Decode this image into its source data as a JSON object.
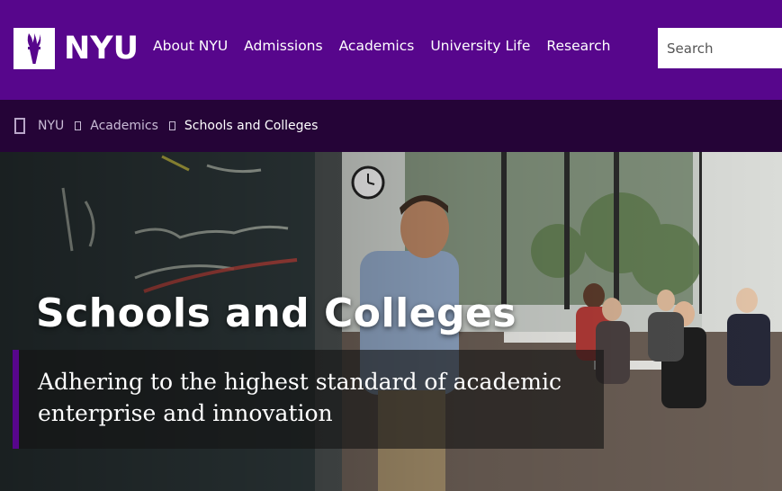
{
  "header": {
    "logo_text": "NYU",
    "nav": [
      {
        "label": "About NYU"
      },
      {
        "label": "Admissions"
      },
      {
        "label": "Academics"
      },
      {
        "label": "University Life"
      },
      {
        "label": "Research"
      }
    ],
    "search_placeholder": "Search"
  },
  "breadcrumb": {
    "items": [
      {
        "label": "NYU"
      },
      {
        "label": "Academics"
      }
    ],
    "current": "Schools and Colleges"
  },
  "hero": {
    "title": "Schools and Colleges",
    "subtitle": "Adhering to the highest standard of academic enterprise and innovation"
  },
  "colors": {
    "brand_purple": "#57068c",
    "breadcrumb_bg": "#250437"
  }
}
